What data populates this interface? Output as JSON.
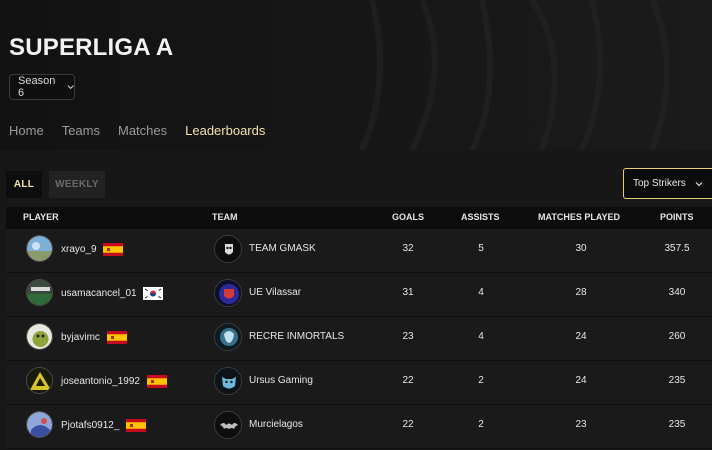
{
  "header": {
    "title": "SUPERLIGA A",
    "season_selected": "Season 6"
  },
  "nav": {
    "items": [
      {
        "label": "Home"
      },
      {
        "label": "Teams"
      },
      {
        "label": "Matches"
      },
      {
        "label": "Leaderboards"
      }
    ],
    "active": "Leaderboards"
  },
  "filters": {
    "all_label": "ALL",
    "weekly_label": "WEEKLY",
    "sort_selected": "Top Strikers"
  },
  "table": {
    "columns": {
      "player": "PLAYER",
      "team": "TEAM",
      "goals": "GOALS",
      "assists": "ASSISTS",
      "matches": "MATCHES PLAYED",
      "points": "POINTS"
    },
    "rows": [
      {
        "player": "xrayo_9",
        "flag": "spain-flag",
        "team": "TEAM GMASK",
        "goals": "32",
        "assists": "5",
        "matches": "30",
        "points": "357.5"
      },
      {
        "player": "usamacancel_01",
        "flag": "south-korea-flag",
        "team": "UE Vilassar",
        "goals": "31",
        "assists": "4",
        "matches": "28",
        "points": "340"
      },
      {
        "player": "byjavimc",
        "flag": "spain-flag",
        "team": "RECRE INMORTALS",
        "goals": "23",
        "assists": "4",
        "matches": "24",
        "points": "260"
      },
      {
        "player": "joseantonio_1992",
        "flag": "spain-flag",
        "team": "Ursus Gaming",
        "goals": "22",
        "assists": "2",
        "matches": "24",
        "points": "235"
      },
      {
        "player": "Pjotafs0912_",
        "flag": "spain-flag",
        "team": "Murcielagos",
        "goals": "22",
        "assists": "2",
        "matches": "23",
        "points": "235"
      }
    ]
  },
  "colors": {
    "accent": "#f1e2a6",
    "accent_border": "#e8cf79",
    "background": "#141414"
  }
}
